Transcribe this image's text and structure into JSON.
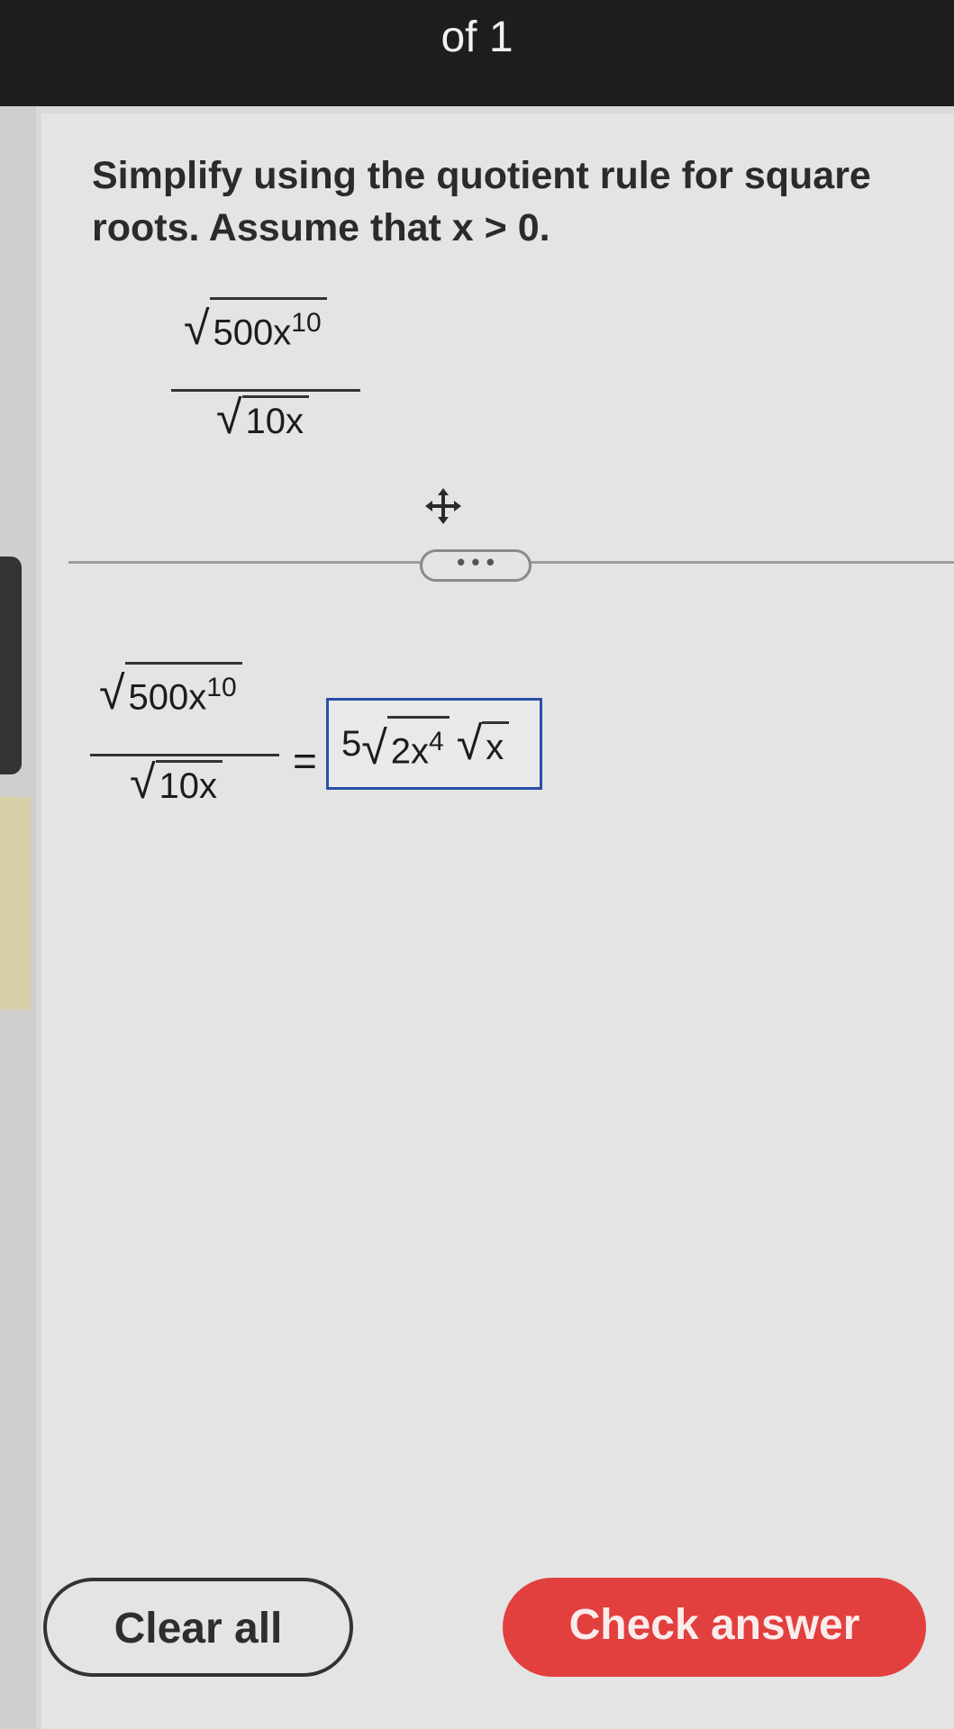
{
  "header": {
    "page_count": "of 1"
  },
  "prompt": {
    "line1": "Simplify using the quotient rule for square",
    "line2": "roots. Assume that x > 0."
  },
  "problem": {
    "numerator_radicand": "500x",
    "numerator_exponent": "10",
    "denominator_radicand": "10x"
  },
  "answer": {
    "equals": "=",
    "coefficient": "5",
    "radicand_1": "2x",
    "radicand_1_exponent": "4",
    "radicand_2": "x"
  },
  "toolbar": {
    "more_label": "• • •"
  },
  "buttons": {
    "clear_label": "Clear all",
    "check_label": "Check answer"
  },
  "icons": {
    "move": "move-icon",
    "sqrt": "sqrt-symbol"
  },
  "colors": {
    "accent_red": "#e23f3f",
    "answer_border": "#2a4fa8",
    "header_bg": "#1d1e1f"
  }
}
